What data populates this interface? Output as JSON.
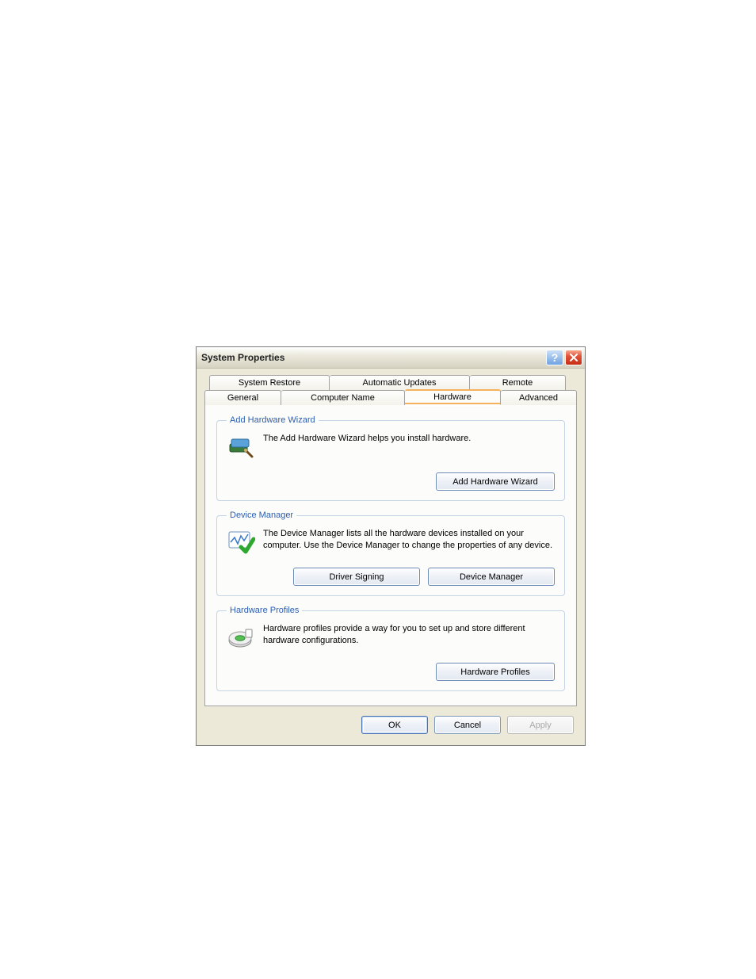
{
  "window": {
    "title": "System Properties"
  },
  "tabs": {
    "row1": {
      "system_restore": "System Restore",
      "automatic_updates": "Automatic Updates",
      "remote": "Remote"
    },
    "row2": {
      "general": "General",
      "computer_name": "Computer Name",
      "hardware": "Hardware",
      "advanced": "Advanced"
    }
  },
  "groups": {
    "add_hardware": {
      "legend": "Add Hardware Wizard",
      "text": "The Add Hardware Wizard helps you install hardware.",
      "button": "Add Hardware Wizard"
    },
    "device_manager": {
      "legend": "Device Manager",
      "text": "The Device Manager lists all the hardware devices installed on your computer. Use the Device Manager to change the properties of any device.",
      "button_signing": "Driver Signing",
      "button_devmgr": "Device Manager"
    },
    "hardware_profiles": {
      "legend": "Hardware Profiles",
      "text": "Hardware profiles provide a way for you to set up and store different hardware configurations.",
      "button": "Hardware Profiles"
    }
  },
  "footer": {
    "ok": "OK",
    "cancel": "Cancel",
    "apply": "Apply"
  }
}
